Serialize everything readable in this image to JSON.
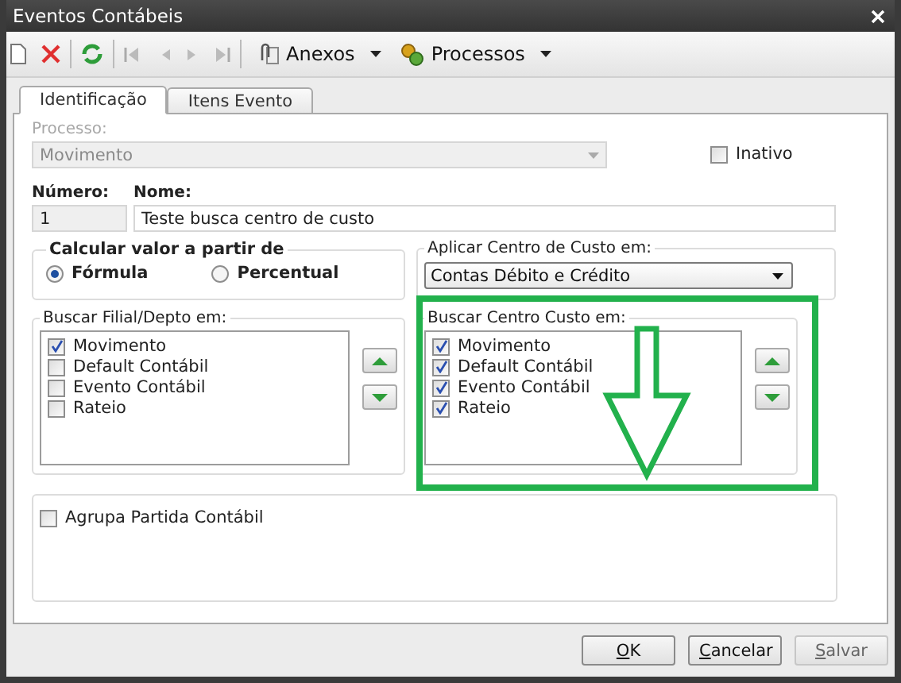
{
  "window": {
    "title": "Eventos Contábeis"
  },
  "toolbar": {
    "menus": [
      {
        "label": "Anexos",
        "kind": "attach"
      },
      {
        "label": "Processos",
        "kind": "process"
      }
    ]
  },
  "tabs": [
    {
      "label": "Identificação",
      "selected": true
    },
    {
      "label": "Itens Evento",
      "selected": false
    }
  ],
  "processo": {
    "label": "Processo:",
    "value": "Movimento",
    "disabled": true
  },
  "inativo": {
    "label": "Inativo",
    "checked": false
  },
  "numero": {
    "label": "Número:",
    "value": "1"
  },
  "nome": {
    "label": "Nome:",
    "value": "Teste busca centro de custo"
  },
  "calcular": {
    "title": "Calcular valor a partir de",
    "options": [
      {
        "label": "Fórmula",
        "selected": true
      },
      {
        "label": "Percentual",
        "selected": false
      }
    ]
  },
  "aplicar": {
    "title": "Aplicar Centro de Custo em:",
    "value": "Contas Débito e Crédito"
  },
  "lists": [
    {
      "title": "Buscar Filial/Depto em:",
      "items": [
        {
          "label": "Movimento",
          "checked": true
        },
        {
          "label": "Default Contábil",
          "checked": false
        },
        {
          "label": "Evento Contábil",
          "checked": false
        },
        {
          "label": "Rateio",
          "checked": false
        }
      ]
    },
    {
      "title": "Buscar Centro Custo em:",
      "items": [
        {
          "label": "Movimento",
          "checked": true
        },
        {
          "label": "Default Contábil",
          "checked": true
        },
        {
          "label": "Evento Contábil",
          "checked": true
        },
        {
          "label": "Rateio",
          "checked": true
        }
      ]
    }
  ],
  "agrupa": {
    "label": "Agrupa Partida Contábil",
    "checked": false
  },
  "buttons": [
    {
      "label": "OK",
      "disabled": false
    },
    {
      "label": "Cancelar",
      "disabled": false
    },
    {
      "label": "Salvar",
      "disabled": true
    }
  ]
}
